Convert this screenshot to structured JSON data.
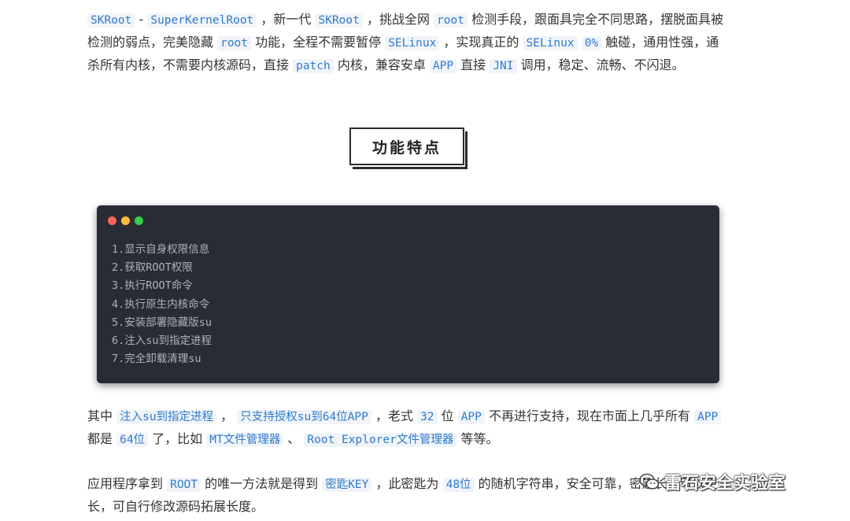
{
  "intro": [
    {
      "code": "SKRoot"
    },
    {
      "text": " - "
    },
    {
      "code": "SuperKernelRoot"
    },
    {
      "text": " ，新一代 "
    },
    {
      "code": "SKRoot"
    },
    {
      "text": " ，挑战全网 "
    },
    {
      "code": "root"
    },
    {
      "text": " 检测手段，跟面具完全不同思路，摆脱面具被检测的弱点，完美隐藏 "
    },
    {
      "code": "root"
    },
    {
      "text": " 功能，全程不需要暂停 "
    },
    {
      "code": "SELinux"
    },
    {
      "text": " ，实现真正的 "
    },
    {
      "code": "SELinux"
    },
    {
      "text": " "
    },
    {
      "code": "0%"
    },
    {
      "text": " 触碰，通用性强，通杀所有内核，不需要内核源码，直接 "
    },
    {
      "code": "patch"
    },
    {
      "text": " 内核，兼容安卓 "
    },
    {
      "code": "APP"
    },
    {
      "text": " 直接 "
    },
    {
      "code": "JNI"
    },
    {
      "text": " 调用，稳定、流畅、不闪退。"
    }
  ],
  "section_heading": "功能特点",
  "features": [
    "1.显示自身权限信息",
    "2.获取ROOT权限",
    "3.执行ROOT命令",
    "4.执行原生内核命令",
    "5.安装部署隐藏版su",
    "6.注入su到指定进程",
    "7.完全卸载清理su"
  ],
  "para2": [
    {
      "text": "其中 "
    },
    {
      "code": "注入su到指定进程"
    },
    {
      "text": " ， "
    },
    {
      "code": "只支持授权su到64位APP"
    },
    {
      "text": " ，老式 "
    },
    {
      "code": "32"
    },
    {
      "text": " 位 "
    },
    {
      "code": "APP"
    },
    {
      "text": " 不再进行支持，现在市面上几乎所有 "
    },
    {
      "code": "APP"
    },
    {
      "text": " 都是 "
    },
    {
      "code": "64位"
    },
    {
      "text": " 了，比如 "
    },
    {
      "code": "MT文件管理器"
    },
    {
      "text": " 、 "
    },
    {
      "code": "Root Explorer文件管理器"
    },
    {
      "text": " 等等。"
    }
  ],
  "para3": [
    {
      "text": "应用程序拿到 "
    },
    {
      "code": "ROOT"
    },
    {
      "text": " 的唯一方法就是得到 "
    },
    {
      "code": "密匙KEY"
    },
    {
      "text": " ，此密匙为 "
    },
    {
      "code": "48位"
    },
    {
      "text": " 的随机字符串，安全可靠，密匙长度可以更长，可自行修改源码拓展长度。"
    }
  ],
  "watermark": "雷石安全实验室"
}
